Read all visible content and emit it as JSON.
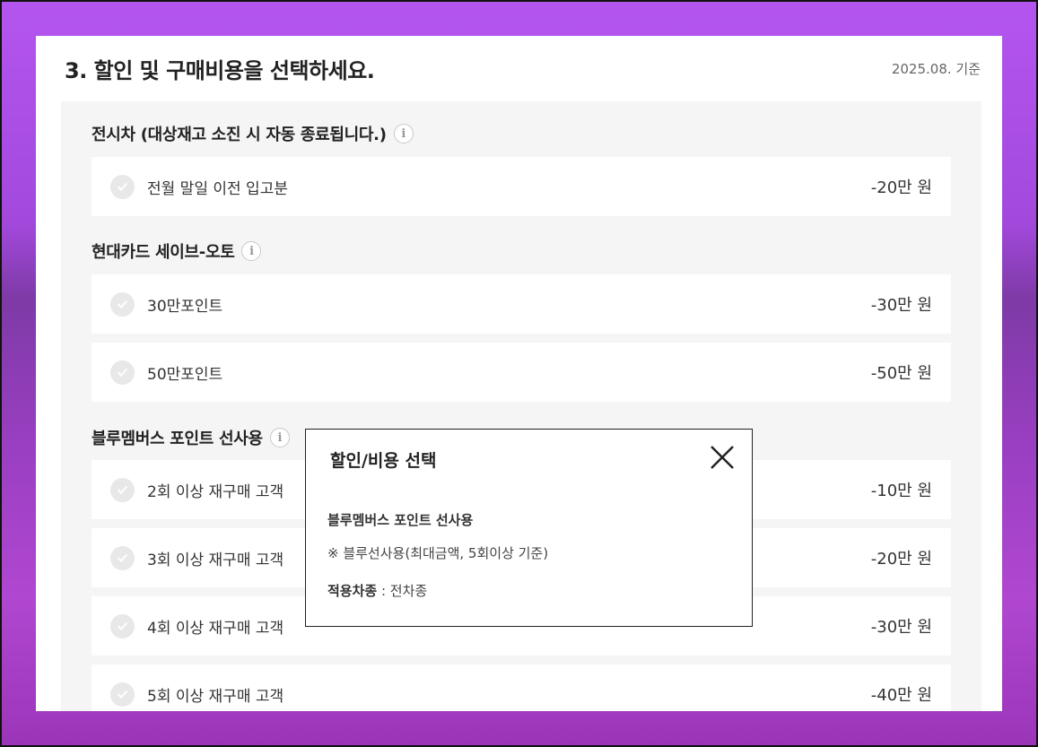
{
  "header": {
    "title": "3. 할인 및 구매비용을 선택하세요.",
    "base_date": "2025.08. 기준"
  },
  "groups": [
    {
      "title": "전시차 (대상재고 소진 시 자동 종료됩니다.)",
      "info_icon": "info-icon",
      "options": [
        {
          "label": "전월 말일 이전 입고분",
          "price": "-20만 원"
        }
      ]
    },
    {
      "title": "현대카드 세이브-오토",
      "info_icon": "info-icon",
      "options": [
        {
          "label": "30만포인트",
          "price": "-30만 원"
        },
        {
          "label": "50만포인트",
          "price": "-50만 원"
        }
      ]
    },
    {
      "title": "블루멤버스 포인트 선사용",
      "info_icon": "info-icon",
      "options": [
        {
          "label": "2회 이상 재구매 고객",
          "price": "-10만 원"
        },
        {
          "label": "3회 이상 재구매 고객",
          "price": "-20만 원"
        },
        {
          "label": "4회 이상 재구매 고객",
          "price": "-30만 원"
        },
        {
          "label": "5회 이상 재구매 고객",
          "price": "-40만 원"
        }
      ]
    }
  ],
  "modal": {
    "title": "할인/비용 선택",
    "subtitle": "블루멤버스 포인트 선사용",
    "note": "※ 블루선사용(최대금액, 5회이상 기준)",
    "apply_label": "적용차종",
    "apply_value": " : 전차종",
    "close_icon": "close-icon"
  },
  "colors": {
    "panel_background": "#ffffff",
    "group_background": "#f5f5f5",
    "check_circle": "#e8e8e8",
    "text_primary": "#222222"
  }
}
